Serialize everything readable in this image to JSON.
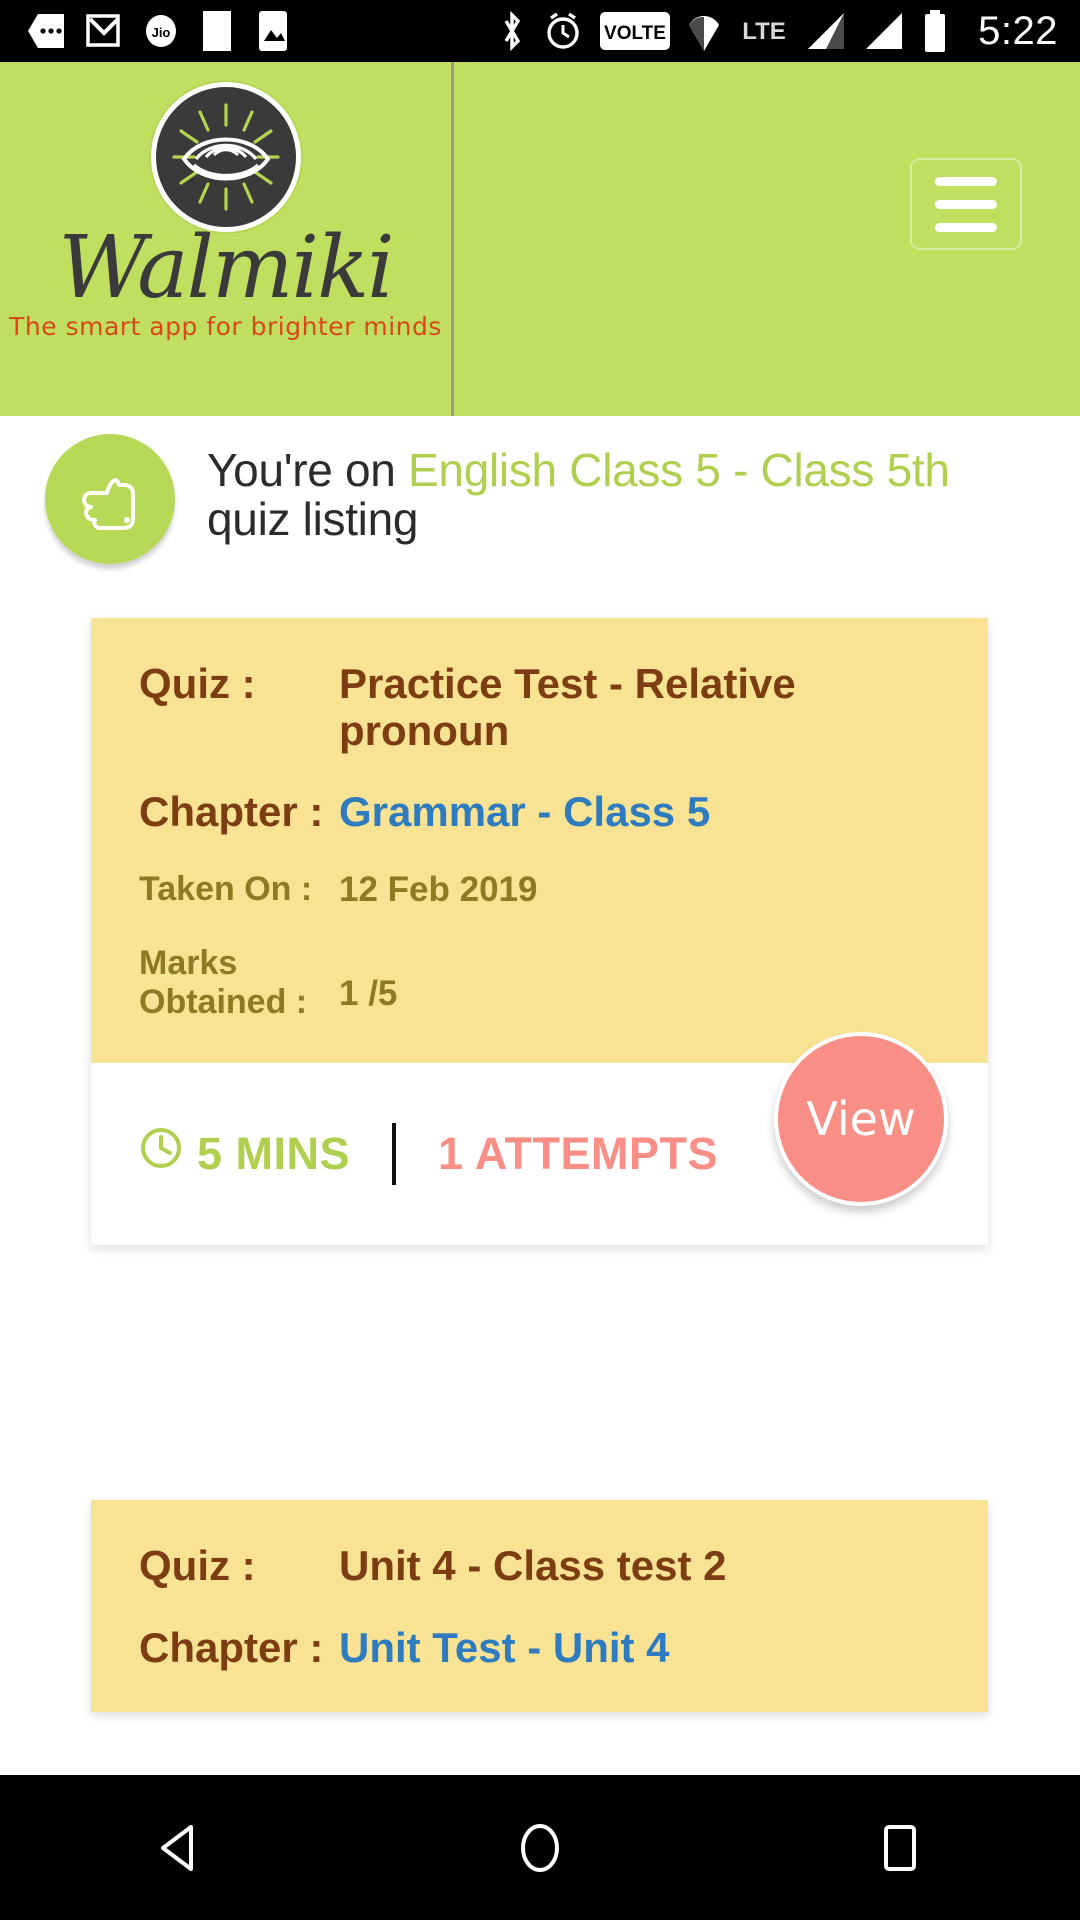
{
  "statusbar": {
    "time": "5:22",
    "left_icons": [
      "more-icon",
      "gmail-icon",
      "jio-icon",
      "app-icon",
      "photos-icon"
    ],
    "right_icons": [
      "bluetooth-icon",
      "alarm-icon",
      "volte-icon",
      "location-icon",
      "lte-icon",
      "signal-1-icon",
      "signal-2-icon",
      "battery-icon"
    ],
    "volte_label": "VOLTE",
    "lte_label": "LTE"
  },
  "header": {
    "brand_name": "Walmiki",
    "tagline": "The smart app for brighter minds",
    "menu_icon": "hamburger-icon",
    "logo_icon": "walmiki-eye-logo",
    "background_color": "#c0df60"
  },
  "breadcrumb": {
    "icon": "thumbs-up-icon",
    "prefix": "You're on ",
    "highlight": "English Class 5 - Class 5th",
    "suffix": " quiz listing",
    "accent_color": "#b0cf4f"
  },
  "cards": [
    {
      "quiz_label": "Quiz :",
      "quiz_value": "Practice Test - Relative pronoun",
      "chapter_label": "Chapter :",
      "chapter_value": "Grammar - Class 5",
      "taken_label": "Taken On :",
      "taken_value": "12 Feb 2019",
      "marks_label": "Marks Obtained :",
      "marks_value": "1 /5",
      "duration": "5 MINS",
      "attempts": "1 ATTEMPTS",
      "view_label": "View",
      "clock_icon": "clock-icon"
    },
    {
      "quiz_label": "Quiz :",
      "quiz_value": "Unit 4 - Class test 2",
      "chapter_label": "Chapter :",
      "chapter_value": "Unit Test - Unit 4"
    }
  ],
  "navbar": {
    "back_icon": "back-triangle-icon",
    "home_icon": "home-circle-icon",
    "recents_icon": "recents-square-icon"
  },
  "colors": {
    "card_background": "#f8e293",
    "label_brown": "#7c3d12",
    "link_blue": "#2f7bbf",
    "olive": "#8d7a24",
    "salmon": "#f98e87",
    "green": "#b0cf4f"
  }
}
